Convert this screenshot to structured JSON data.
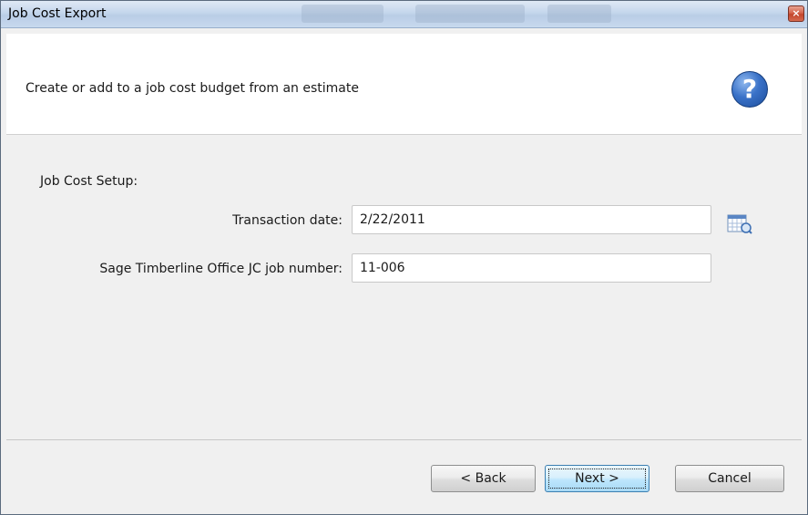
{
  "window": {
    "title": "Job Cost Export",
    "close_label": "×"
  },
  "header": {
    "heading": "Create or add to a job cost budget from an estimate",
    "help_glyph": "?"
  },
  "setup": {
    "section_label": "Job Cost Setup:",
    "transaction_date": {
      "label": "Transaction date:",
      "value": "2/22/2011"
    },
    "job_number": {
      "label": "Sage Timberline Office JC job number:",
      "value": "11-006"
    }
  },
  "footer": {
    "back_label": "< Back",
    "next_label": "Next >",
    "cancel_label": "Cancel"
  },
  "colors": {
    "accent": "#3a72c8",
    "default_button_border": "#3c7fb1",
    "close_button": "#c3452c"
  },
  "icons": {
    "help": "help-icon",
    "calendar": "calendar-icon",
    "close": "close-icon"
  }
}
